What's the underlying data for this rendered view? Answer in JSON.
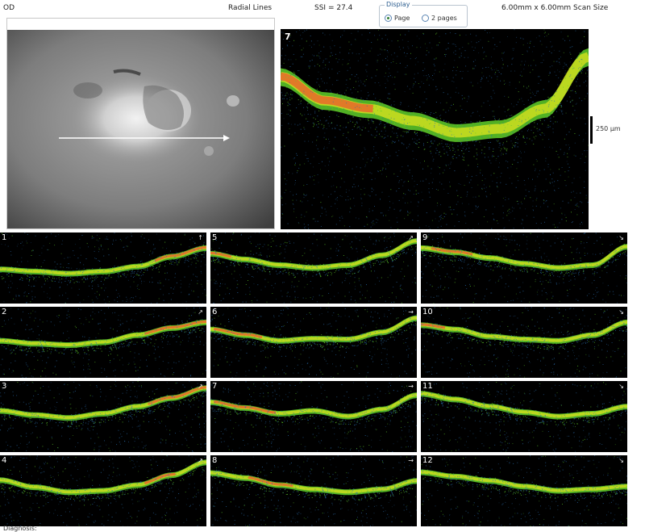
{
  "header": {
    "eye": "OD",
    "scan_type": "Radial Lines",
    "ssi": "SSI = 27.4",
    "scan_size": "6.00mm x 6.00mm Scan Size",
    "display": {
      "title": "Display",
      "options": [
        {
          "label": "Page",
          "selected": true
        },
        {
          "label": "2 pages",
          "selected": false
        }
      ]
    }
  },
  "main_scan": {
    "label": "7",
    "scale_label": "250 µm"
  },
  "thumbnails": [
    {
      "label": "1",
      "arrow": "↑"
    },
    {
      "label": "2",
      "arrow": "↗"
    },
    {
      "label": "3",
      "arrow": "↗"
    },
    {
      "label": "4",
      "arrow": "↗"
    },
    {
      "label": "5",
      "arrow": "↗"
    },
    {
      "label": "6",
      "arrow": "→"
    },
    {
      "label": "7",
      "arrow": "→"
    },
    {
      "label": "8",
      "arrow": "→"
    },
    {
      "label": "9",
      "arrow": "↘"
    },
    {
      "label": "10",
      "arrow": "↘"
    },
    {
      "label": "11",
      "arrow": "↘"
    },
    {
      "label": "12",
      "arrow": "↘"
    }
  ],
  "footer": {
    "diagnosis": "Diagnosis:"
  },
  "colors": {
    "scan_background": "#000000",
    "retina_layer": "#5fcf2a",
    "retina_core": "#d6e21f",
    "hot_band": "#e8682a",
    "speckle": "#2b6fb0"
  }
}
